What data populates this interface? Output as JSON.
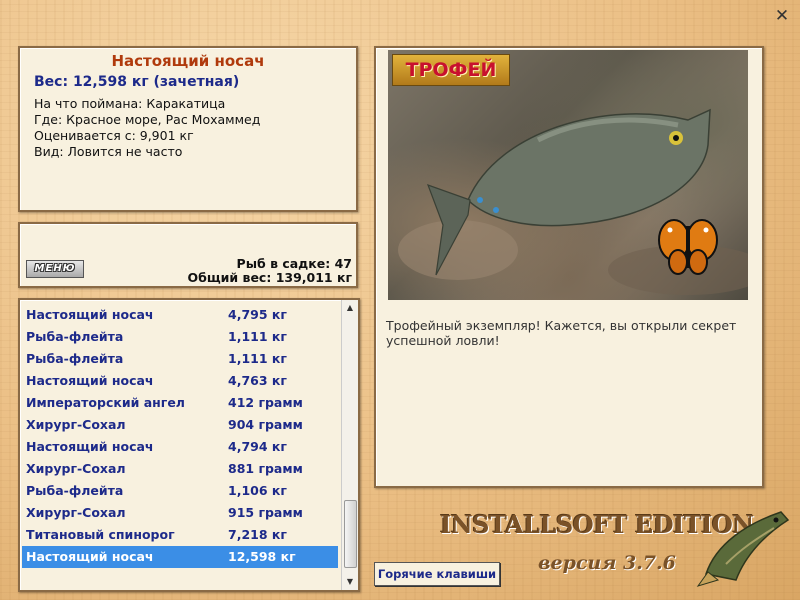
{
  "fish_info": {
    "title": "Настоящий носач",
    "weight": "Вес: 12,598 кг (зачетная)",
    "details": [
      "На что поймана: Каракатица",
      "Где: Красное море, Рас Мохаммед",
      "Оценивается с: 9,901 кг",
      "Вид: Ловится не часто"
    ]
  },
  "stats": {
    "menu_label": "МЕНЮ",
    "fish_count": "Рыб в садке: 47",
    "total_weight": "Общий вес: 139,011 кг"
  },
  "catch_list": [
    {
      "name": "Настоящий носач",
      "weight": "4,795 кг"
    },
    {
      "name": "Рыба-флейта",
      "weight": "1,111 кг"
    },
    {
      "name": "Рыба-флейта",
      "weight": "1,111 кг"
    },
    {
      "name": "Настоящий носач",
      "weight": "4,763 кг"
    },
    {
      "name": "Императорский ангел",
      "weight": "412 грамм"
    },
    {
      "name": "Хирург-Сохал",
      "weight": "904 грамм"
    },
    {
      "name": "Настоящий носач",
      "weight": "4,794 кг"
    },
    {
      "name": "Хирург-Сохал",
      "weight": "881 грамм"
    },
    {
      "name": "Рыба-флейта",
      "weight": "1,106 кг"
    },
    {
      "name": "Хирург-Сохал",
      "weight": "915 грамм"
    },
    {
      "name": "Титановый спинорог",
      "weight": "7,218 кг"
    },
    {
      "name": "Настоящий носач",
      "weight": "12,598 кг"
    }
  ],
  "selected_index": 11,
  "trophy": {
    "badge": "ТРОФЕЙ",
    "caption": "Трофейный экземпляр! Кажется, вы открыли секрет успешной ловли!"
  },
  "footer": {
    "hotkeys_label": "Горячие клавиши",
    "edition": "INSTALLSOFT EDITION",
    "version": "версия 3.7.6"
  },
  "colors": {
    "title": "#b03a0c",
    "list_text": "#1d2a8a",
    "selected_row": "#3b8ee6"
  },
  "icons": {
    "close": "close-icon",
    "fish_photo": "unicornfish-photo",
    "butterfly": "butterfly-icon",
    "logo": "pike-fish-logo"
  }
}
